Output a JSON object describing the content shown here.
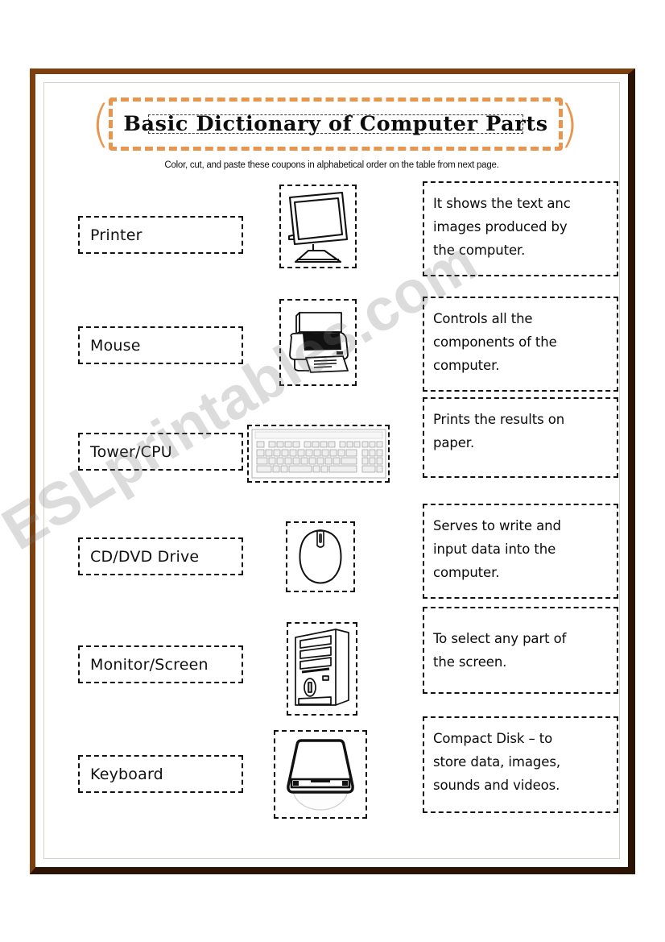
{
  "document": {
    "title": "Basic Dictionary of Computer Parts",
    "subtitle": "Color, cut, and paste these coupons in alphabetical order on the table from next page.",
    "paren_left": "(",
    "paren_right": ")",
    "watermark": "ESLprintables.com"
  },
  "colors": {
    "frame_outer_light": "#7b3f10",
    "frame_outer_dark": "#2b1405",
    "accent_orange": "#e8954e",
    "ink": "#111111",
    "page": "#ffffff"
  },
  "rows": [
    {
      "word": "Printer",
      "picture": "monitor-icon",
      "picture_label": "monitor",
      "definition": [
        "It shows the text anc",
        "images produced by",
        "the computer."
      ]
    },
    {
      "word": "Mouse",
      "picture": "printer-icon",
      "picture_label": "printer",
      "definition": [
        "Controls all the",
        "components of the",
        "computer."
      ]
    },
    {
      "word": "Tower/CPU",
      "picture": "keyboard-icon",
      "picture_label": "keyboard",
      "definition": [
        "Prints the results on",
        "paper."
      ]
    },
    {
      "word": "CD/DVD Drive",
      "picture": "mouse-icon",
      "picture_label": "mouse",
      "definition": [
        "Serves to write and",
        "input data into the",
        "computer."
      ]
    },
    {
      "word": "Monitor/Screen",
      "picture": "tower-icon",
      "picture_label": "computer tower",
      "definition": [
        "To select any part of",
        "the screen."
      ]
    },
    {
      "word": "Keyboard",
      "picture": "cd-drive-icon",
      "picture_label": "CD/DVD drive",
      "definition": [
        "Compact Disk – to",
        "store data, images,",
        "sounds and videos."
      ]
    }
  ]
}
